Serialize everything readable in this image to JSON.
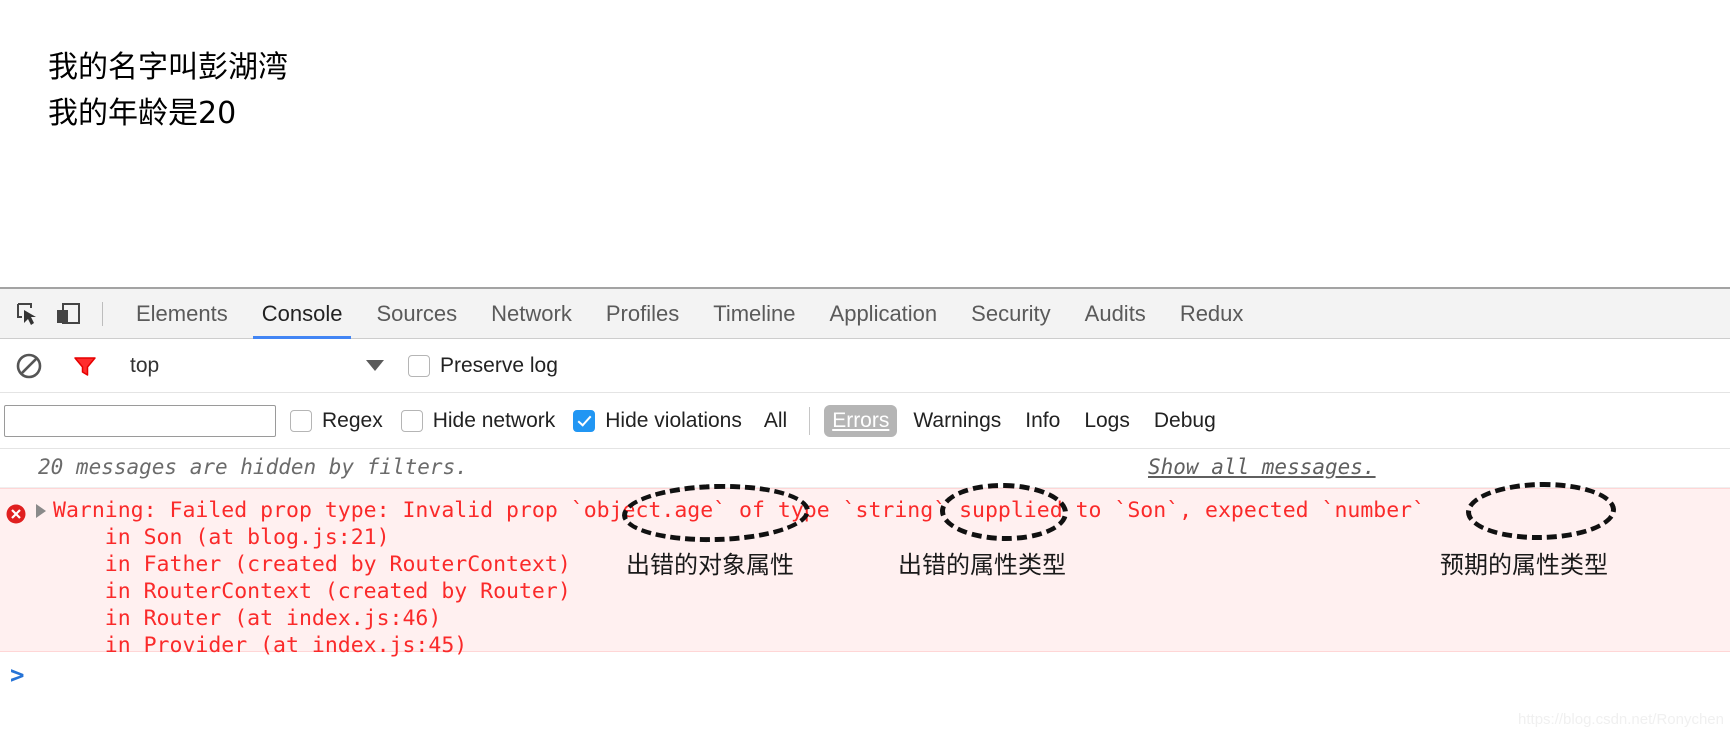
{
  "page_preview": {
    "line1": "我的名字叫彭湖湾",
    "line2": "我的年龄是20"
  },
  "devtools": {
    "icons": {
      "inspect": "inspect-element-icon",
      "device": "device-toolbar-icon"
    },
    "tabs": [
      {
        "label": "Elements",
        "active": false
      },
      {
        "label": "Console",
        "active": true
      },
      {
        "label": "Sources",
        "active": false
      },
      {
        "label": "Network",
        "active": false
      },
      {
        "label": "Profiles",
        "active": false
      },
      {
        "label": "Timeline",
        "active": false
      },
      {
        "label": "Application",
        "active": false
      },
      {
        "label": "Security",
        "active": false
      },
      {
        "label": "Audits",
        "active": false
      },
      {
        "label": "Redux",
        "active": false
      }
    ],
    "accent_color": "#4285f4",
    "console_toolbar": {
      "clear_icon": "clear-console-icon",
      "filter_icon": "filter-funnel-icon",
      "context": "top",
      "preserve_log_label": "Preserve log",
      "preserve_log_checked": false
    },
    "filter_toolbar": {
      "filter_value": "",
      "filter_placeholder": "",
      "regex_label": "Regex",
      "regex_checked": false,
      "hide_network_label": "Hide network",
      "hide_network_checked": false,
      "hide_violations_label": "Hide violations",
      "hide_violations_checked": true,
      "levels": [
        {
          "label": "All",
          "active": false
        },
        {
          "label": "Errors",
          "active": true
        },
        {
          "label": "Warnings",
          "active": false
        },
        {
          "label": "Info",
          "active": false
        },
        {
          "label": "Logs",
          "active": false
        },
        {
          "label": "Debug",
          "active": false
        }
      ]
    },
    "hidden_banner": {
      "message": "20 messages are hidden by filters.",
      "show_all_label": "Show all messages."
    },
    "console_error": {
      "icon": "error-circle-icon",
      "expander": "disclosure-triangle-collapsed-icon",
      "main": "Warning: Failed prop type: Invalid prop `object.age` of type `string` supplied to `Son`, expected `number`",
      "stack": [
        "    in Son (at blog.js:21)",
        "    in Father (created by RouterContext)",
        "    in RouterContext (created by Router)",
        "    in Router (at index.js:46)",
        "    in Provider (at index.js:45)"
      ],
      "text_color": "#fa2a2a",
      "background_color": "#fff0f0"
    },
    "annotations": {
      "circled_terms": [
        "`object.age`",
        "`string`",
        "`number`"
      ],
      "label_1": "出错的对象属性",
      "label_2": "出错的属性类型",
      "label_3": "预期的属性类型",
      "circle_color": "#111111"
    },
    "prompt": {
      "chevron": ">"
    }
  },
  "watermark": "https://blog.csdn.net/Ronychen"
}
